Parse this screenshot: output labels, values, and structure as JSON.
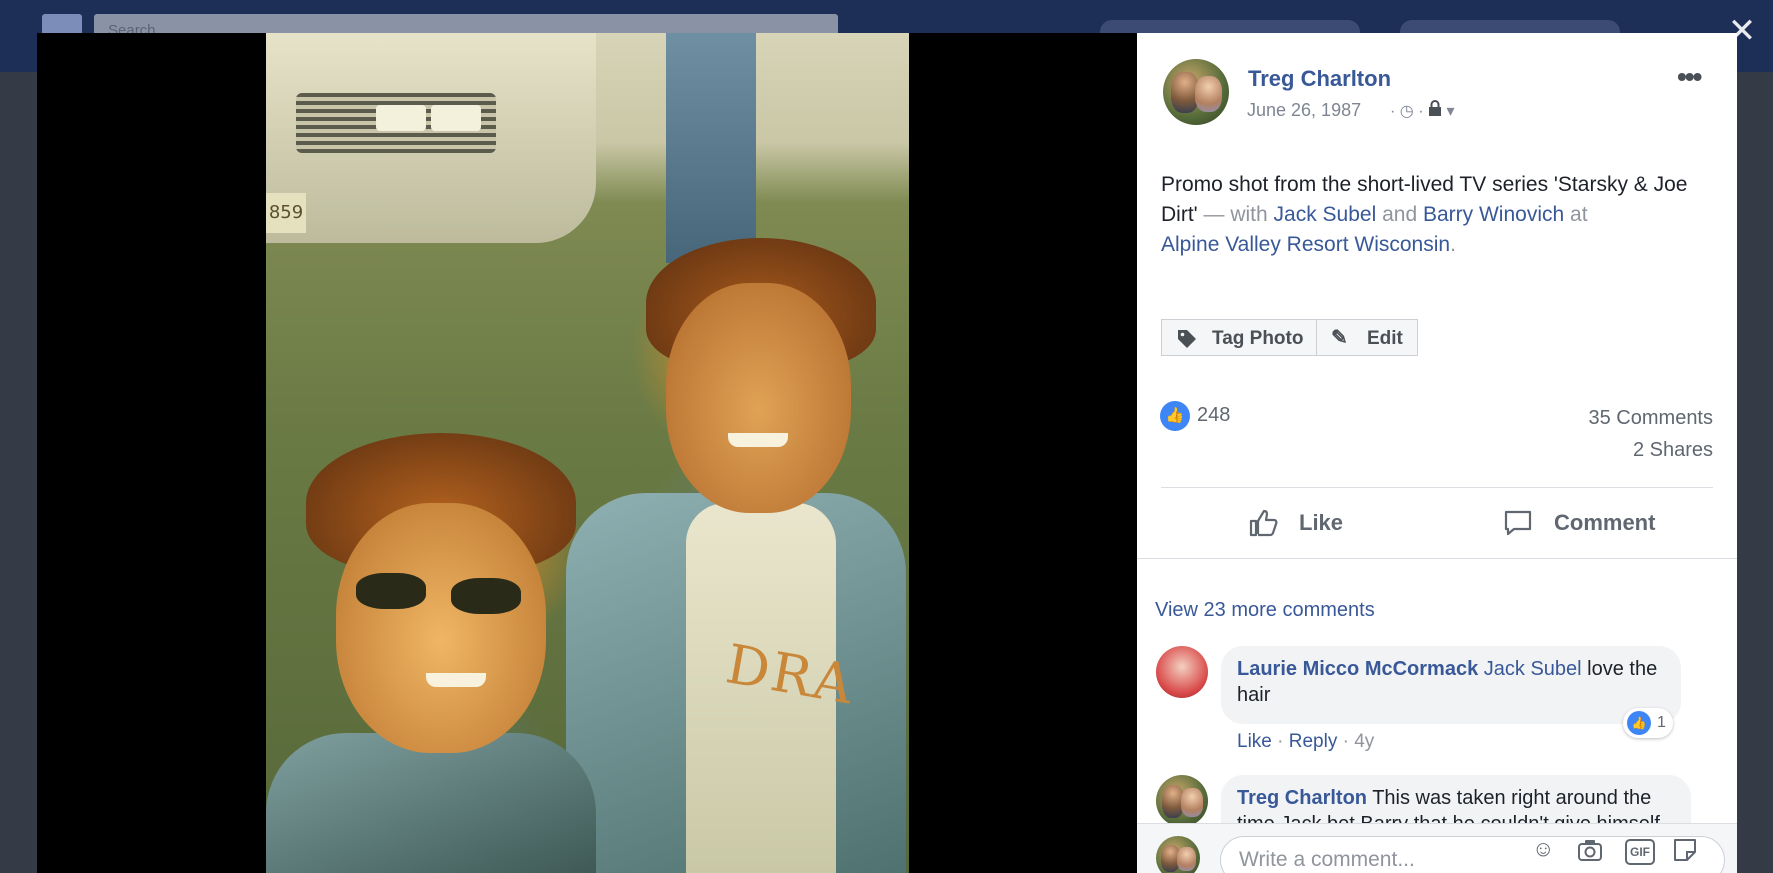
{
  "facebook": {
    "search_placeholder": "Search"
  },
  "photo": {
    "plate_text": "859",
    "shirt_text": "DRA"
  },
  "post": {
    "author": "Treg Charlton",
    "date": "June 26, 1987",
    "date_separator": " · ",
    "caption_text": "Promo shot from the short-lived TV series 'Starsky & Joe Dirt'",
    "caption_with": " — with ",
    "tagged_1": "Jack Subel",
    "caption_and": " and ",
    "tagged_2": "Barry Winovich",
    "caption_at": " at ",
    "location": "Alpine Valley Resort Wisconsin",
    "caption_end": "."
  },
  "buttons": {
    "tag_photo": "Tag Photo",
    "edit": "Edit"
  },
  "stats": {
    "likes": "248",
    "comments": "35 Comments",
    "shares": "2 Shares"
  },
  "actions": {
    "like": "Like",
    "comment": "Comment"
  },
  "comments": {
    "view_more": "View 23 more comments",
    "items": [
      {
        "author": "Laurie Micco McCormack",
        "tag": "Jack Subel",
        "text": " love the hair",
        "like": "Like",
        "reply": "Reply",
        "age": "4y",
        "reactions": "1"
      },
      {
        "author": "Treg Charlton",
        "text": " This was taken right around the time Jack bet Barry that he couldn't give himself a haircut."
      }
    ]
  },
  "composer": {
    "placeholder": "Write a comment..."
  },
  "colors": {
    "link": "#385898",
    "like_blue": "#3e86f5",
    "topbar": "#1d2e57"
  },
  "icons": [
    "search-icon",
    "close-icon",
    "more-icon",
    "clock-icon",
    "lock-icon",
    "chevron-down-icon",
    "tag-icon",
    "pencil-icon",
    "like-icon",
    "comment-icon",
    "emoji-icon",
    "camera-icon",
    "gif-icon",
    "sticker-icon"
  ]
}
